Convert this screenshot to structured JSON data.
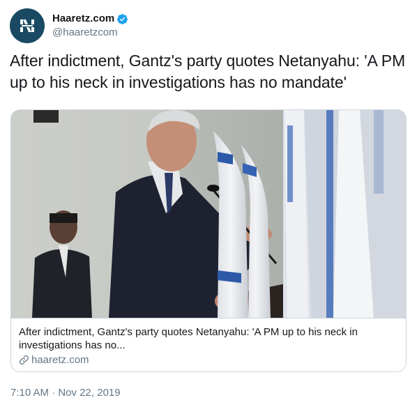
{
  "tweet": {
    "display_name": "Haaretz.com",
    "handle": "@haaretzcom",
    "verified_icon": "verified-badge-icon",
    "text": "After indictment, Gantz's party quotes Netanyahu: 'A PM up to his neck in investigations has no mandate'",
    "timestamp": "7:10 AM · Nov 22, 2019"
  },
  "card": {
    "title": "After indictment, Gantz's party quotes Netanyahu: 'A PM up to his neck in investigations has no...",
    "domain": "haaretz.com",
    "link_icon": "link-icon"
  },
  "colors": {
    "text": "#14171a",
    "secondary": "#657786",
    "border": "#ccd6dd",
    "verified": "#1da1f2",
    "avatar_bg": "#1a4a63"
  }
}
